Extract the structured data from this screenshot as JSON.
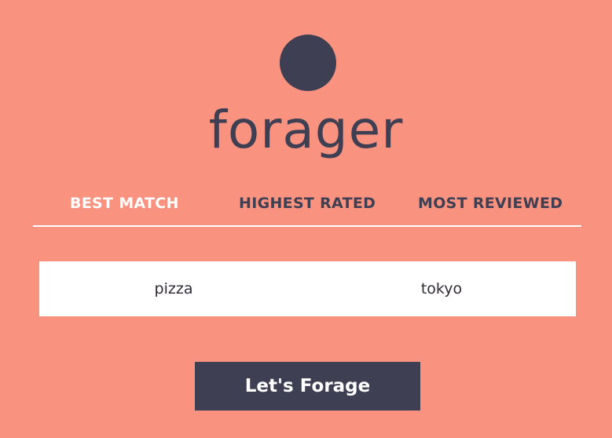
{
  "brand": {
    "name": "forager"
  },
  "tabs": [
    {
      "label": "BEST MATCH",
      "active": true
    },
    {
      "label": "HIGHEST RATED",
      "active": false
    },
    {
      "label": "MOST REVIEWED",
      "active": false
    }
  ],
  "search": {
    "term_value": "pizza",
    "location_value": "tokyo"
  },
  "actions": {
    "forage_label": "Let's Forage"
  },
  "colors": {
    "background": "#f9927f",
    "primary": "#3f3f53",
    "active_tab": "#ffffff",
    "search_bg": "#ffffff"
  }
}
